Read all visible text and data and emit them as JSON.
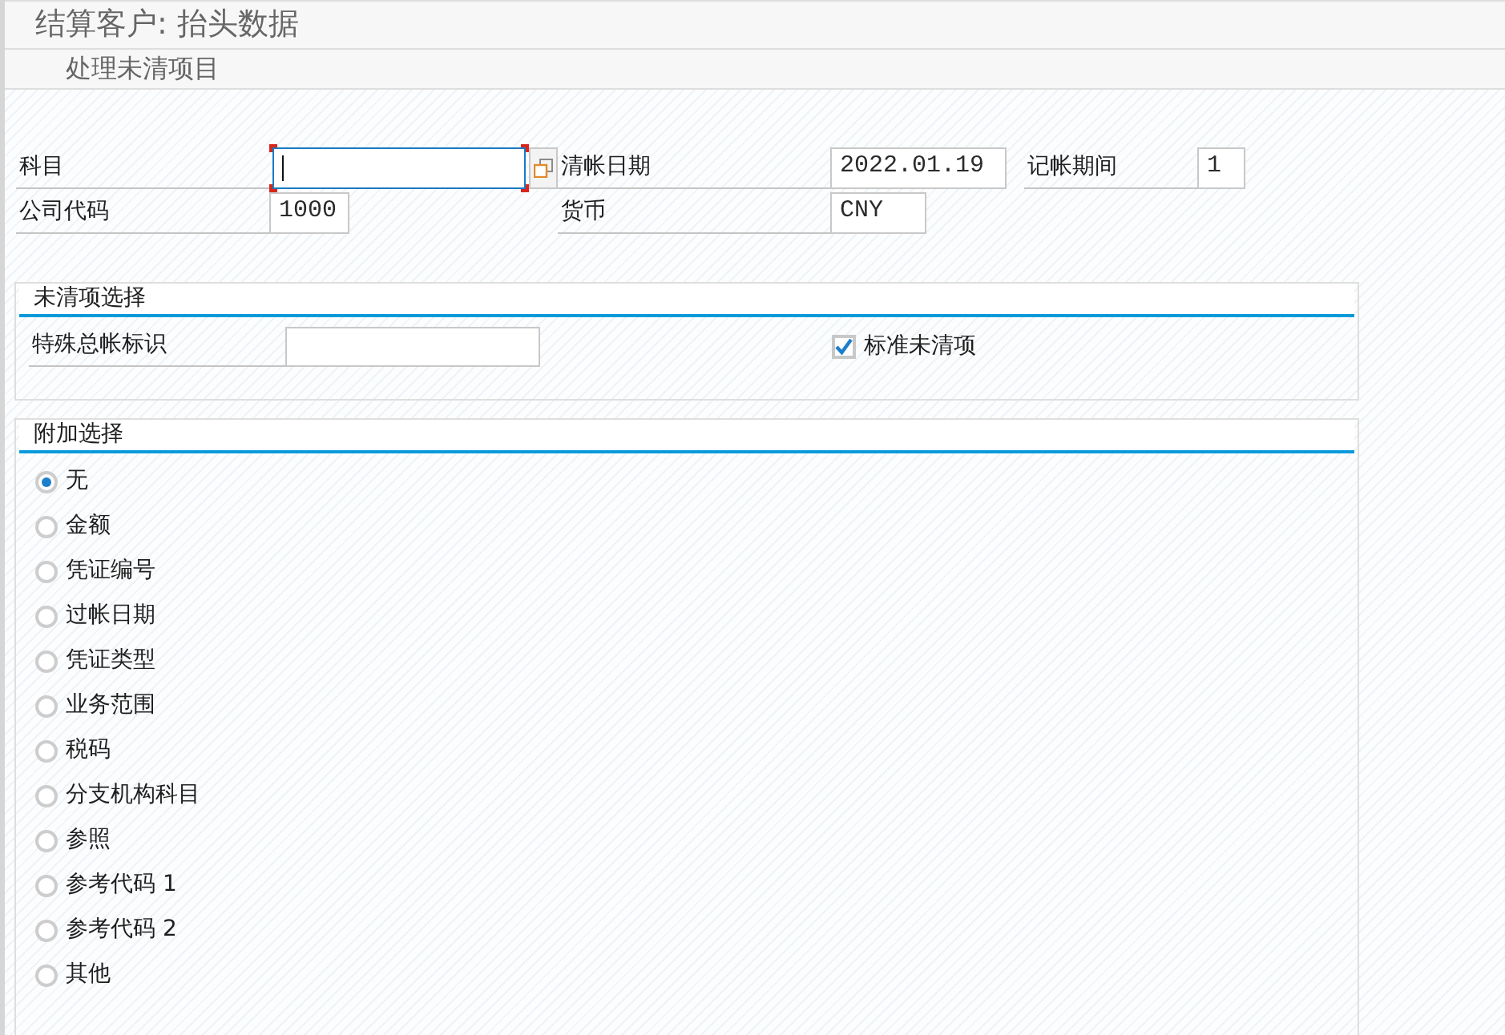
{
  "header": {
    "title": "结算客户: 抬头数据"
  },
  "toolbar": {
    "buttons": [
      {
        "label": "处理未清项目"
      }
    ]
  },
  "header_rows": [
    {
      "fields": [
        {
          "label": "科目",
          "focused": true
        },
        {
          "label": "清帐日期",
          "value": "2022.01.19",
          "focused": false
        },
        {
          "label": "记帐期间",
          "value": "1",
          "focused": false
        }
      ]
    },
    {
      "fields": [
        {
          "label": "公司代码",
          "value": "1000",
          "focused": false
        },
        {
          "label": "货币",
          "value": "CNY",
          "focused": false
        }
      ]
    }
  ],
  "open_item_selection": {
    "title": "未清项选择",
    "fields": [
      {
        "label": "特殊总帐标识",
        "focused": false
      }
    ],
    "checkboxes": [
      {
        "label": "标准未清项",
        "checked": true
      }
    ]
  },
  "additional_selection": {
    "title": "附加选择",
    "options": [
      {
        "label": "无",
        "selected": true
      },
      {
        "label": "金额",
        "selected": false
      },
      {
        "label": "凭证编号",
        "selected": false
      },
      {
        "label": "过帐日期",
        "selected": false
      },
      {
        "label": "凭证类型",
        "selected": false
      },
      {
        "label": "业务范围",
        "selected": false
      },
      {
        "label": "税码",
        "selected": false
      },
      {
        "label": "分支机构科目",
        "selected": false
      },
      {
        "label": "参照",
        "selected": false
      },
      {
        "label": "参考代码 1",
        "selected": false
      },
      {
        "label": "参考代码 2",
        "selected": false
      },
      {
        "label": "其他",
        "selected": false
      }
    ]
  }
}
